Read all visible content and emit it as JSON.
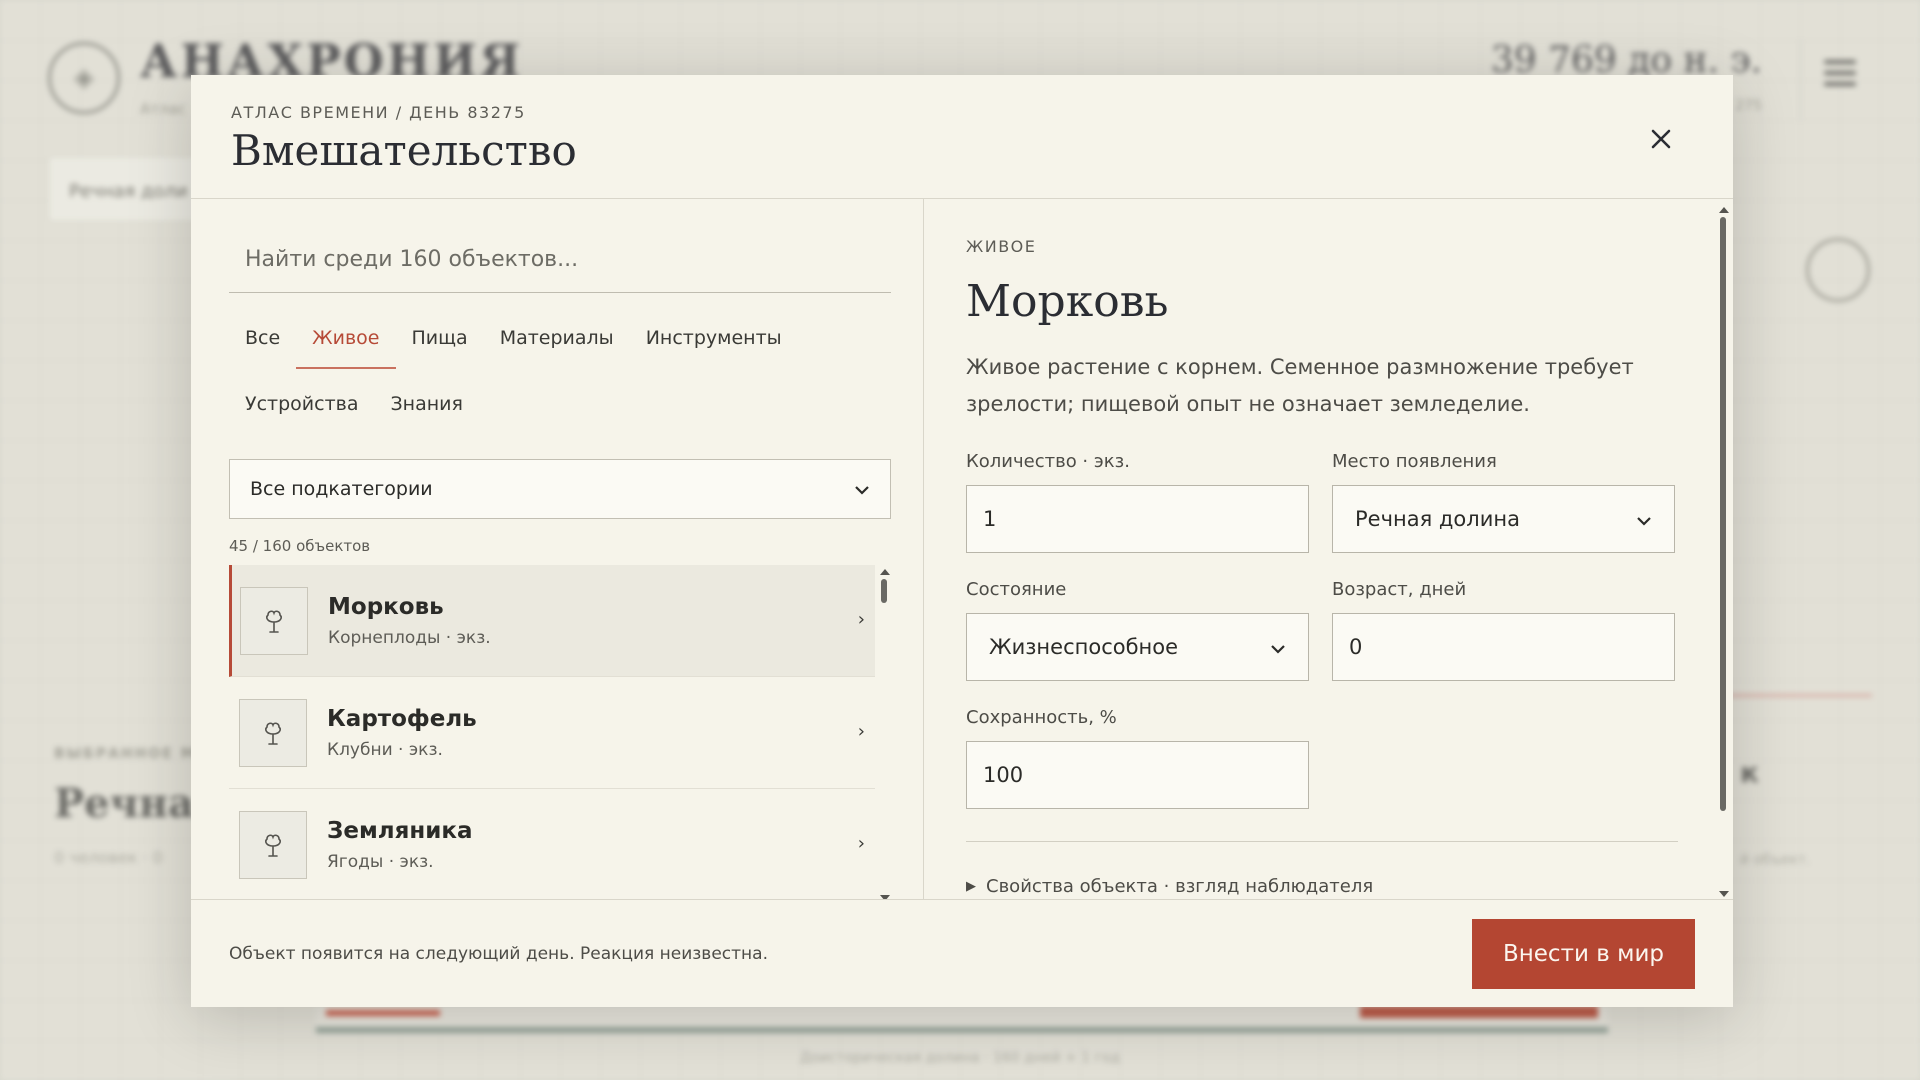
{
  "background": {
    "brand": "АНАХРОНИЯ",
    "brand_sub": "Атлас",
    "date": "39 769 до н. э.",
    "date_sub": "275",
    "chip": "Речная доли",
    "label": "ВЫБРАННОЕ М",
    "heading": "Речная",
    "small": "0 человек · 0",
    "right_text": "к",
    "right_small": "й объект.",
    "footer": "Доисторическая долина · 160 дней + 1 год"
  },
  "modal": {
    "breadcrumb": "АТЛАС ВРЕМЕНИ / ДЕНЬ 83275",
    "title": "Вмешательство"
  },
  "search": {
    "placeholder": "Найти среди 160 объектов..."
  },
  "tabs": [
    {
      "label": "Все"
    },
    {
      "label": "Живое"
    },
    {
      "label": "Пища"
    },
    {
      "label": "Материалы"
    },
    {
      "label": "Инструменты"
    },
    {
      "label": "Устройства"
    },
    {
      "label": "Знания"
    }
  ],
  "subcategory": {
    "selected": "Все подкатегории"
  },
  "count_text": "45 / 160 объектов",
  "items": [
    {
      "name": "Морковь",
      "sub": "Корнеплоды · экз.",
      "icon": "plant-icon"
    },
    {
      "name": "Картофель",
      "sub": "Клубни · экз.",
      "icon": "plant-icon"
    },
    {
      "name": "Земляника",
      "sub": "Ягоды · экз.",
      "icon": "plant-icon"
    }
  ],
  "detail": {
    "eyebrow": "ЖИВОЕ",
    "title": "Морковь",
    "description": "Живое растение с корнем. Семенное размножение требует зрелости; пищевой опыт не означает земледелие.",
    "fields": {
      "quantity_label": "Количество · экз.",
      "quantity_value": "1",
      "place_label": "Место появления",
      "place_value": "Речная долина",
      "state_label": "Состояние",
      "state_value": "Жизнеспособное",
      "age_label": "Возраст, дней",
      "age_value": "0",
      "preservation_label": "Сохранность, %",
      "preservation_value": "100"
    },
    "collapsible": "Свойства объекта · взгляд наблюдателя"
  },
  "footer": {
    "note": "Объект появится на следующий день. Реакция неизвестна.",
    "submit_label": "Внести в мир"
  },
  "colors": {
    "accent": "#b44632",
    "background": "#f6f4ea"
  }
}
